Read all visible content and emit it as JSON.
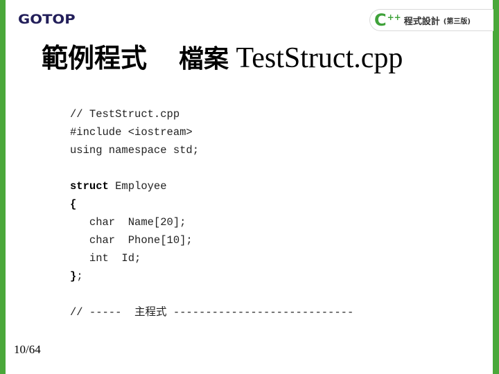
{
  "decor": {
    "accent_color": "#4aa83a"
  },
  "header": {
    "publisher_logo": "GOTOP",
    "book_badge": {
      "c_letter": "C",
      "plus_plus": "++",
      "title": "程式設計",
      "edition": "(第三版)"
    }
  },
  "slide": {
    "title_part1": "範例程式",
    "title_part2": "檔案",
    "title_file": "TestStruct.cpp"
  },
  "code": {
    "lines": [
      {
        "text": "// TestStruct.cpp"
      },
      {
        "text": "#include <iostream>"
      },
      {
        "text": "using namespace std;"
      },
      {
        "text": ""
      },
      {
        "keyword": "struct",
        "rest": " Employee"
      },
      {
        "keyword": "{",
        "rest": ""
      },
      {
        "text": "   char  Name[20];"
      },
      {
        "text": "   char  Phone[10];"
      },
      {
        "text": "   int  Id;"
      },
      {
        "keyword": "}",
        "rest": ";"
      },
      {
        "text": ""
      },
      {
        "text": "// -----  主程式 ----------------------------"
      }
    ]
  },
  "footer": {
    "page_number": "10/64"
  }
}
